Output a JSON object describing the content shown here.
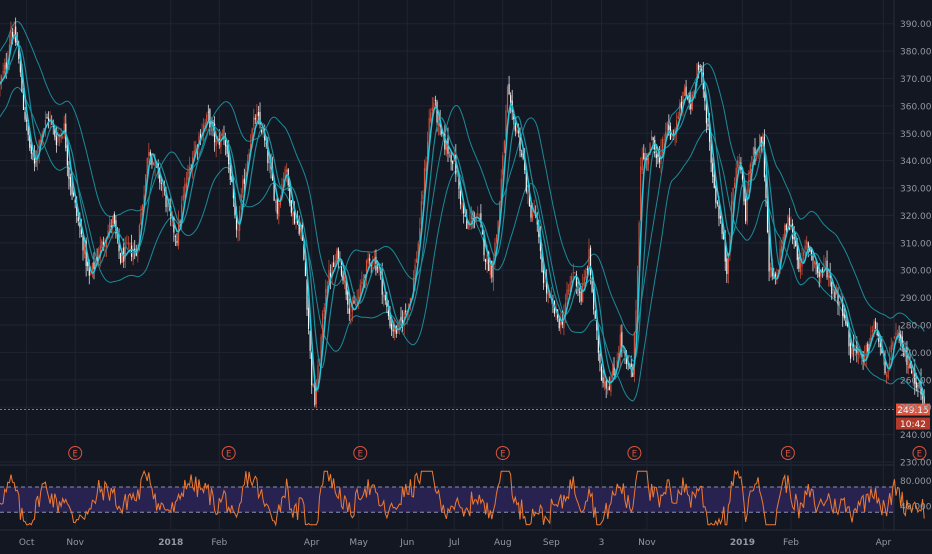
{
  "chart_data": [
    {
      "type": "candlestick",
      "panel": "price",
      "ylim": [
        230,
        395
      ],
      "y_ticks": [
        230,
        240,
        250,
        260,
        270,
        280,
        290,
        300,
        310,
        320,
        330,
        340,
        350,
        360,
        370,
        380,
        390
      ],
      "y_tick_labels": [
        "230.00",
        "240.00",
        "250.00",
        "260.00",
        "270.00",
        "280.00",
        "290.00",
        "300.00",
        "310.00",
        "320.00",
        "330.00",
        "340.00",
        "350.00",
        "360.00",
        "370.00",
        "380.00",
        "390.00"
      ],
      "x_range": [
        "2017-09-14",
        "2019-05-02"
      ],
      "x_ticks": [
        {
          "date": "2017-10-01",
          "label": "Oct",
          "bold": false
        },
        {
          "date": "2017-11-01",
          "label": "Nov",
          "bold": false
        },
        {
          "date": "2018-01-01",
          "label": "2018",
          "bold": true
        },
        {
          "date": "2018-02-01",
          "label": "Feb",
          "bold": false
        },
        {
          "date": "2018-04-01",
          "label": "Apr",
          "bold": false
        },
        {
          "date": "2018-05-01",
          "label": "May",
          "bold": false
        },
        {
          "date": "2018-06-01",
          "label": "Jun",
          "bold": false
        },
        {
          "date": "2018-07-01",
          "label": "Jul",
          "bold": false
        },
        {
          "date": "2018-08-01",
          "label": "Aug",
          "bold": false
        },
        {
          "date": "2018-09-01",
          "label": "Sep",
          "bold": false
        },
        {
          "date": "2018-10-03",
          "label": "3",
          "bold": false
        },
        {
          "date": "2018-11-01",
          "label": "Nov",
          "bold": false
        },
        {
          "date": "2019-01-01",
          "label": "2019",
          "bold": true
        },
        {
          "date": "2019-02-01",
          "label": "Feb",
          "bold": false
        },
        {
          "date": "2019-04-01",
          "label": "Apr",
          "bold": false
        }
      ],
      "close_path": [
        [
          "2017-09-14",
          368
        ],
        [
          "2017-09-18",
          375
        ],
        [
          "2017-09-21",
          388
        ],
        [
          "2017-09-25",
          382
        ],
        [
          "2017-09-29",
          360
        ],
        [
          "2017-10-03",
          345
        ],
        [
          "2017-10-06",
          338
        ],
        [
          "2017-10-10",
          350
        ],
        [
          "2017-10-15",
          356
        ],
        [
          "2017-10-20",
          348
        ],
        [
          "2017-10-25",
          352
        ],
        [
          "2017-10-28",
          335
        ],
        [
          "2017-11-02",
          320
        ],
        [
          "2017-11-06",
          310
        ],
        [
          "2017-11-10",
          297
        ],
        [
          "2017-11-15",
          305
        ],
        [
          "2017-11-20",
          312
        ],
        [
          "2017-11-25",
          318
        ],
        [
          "2017-11-30",
          304
        ],
        [
          "2017-12-05",
          308
        ],
        [
          "2017-12-10",
          306
        ],
        [
          "2017-12-15",
          330
        ],
        [
          "2017-12-18",
          345
        ],
        [
          "2017-12-22",
          338
        ],
        [
          "2017-12-27",
          330
        ],
        [
          "2018-01-01",
          318
        ],
        [
          "2018-01-05",
          312
        ],
        [
          "2018-01-10",
          330
        ],
        [
          "2018-01-15",
          342
        ],
        [
          "2018-01-20",
          350
        ],
        [
          "2018-01-25",
          356
        ],
        [
          "2018-01-30",
          346
        ],
        [
          "2018-02-04",
          350
        ],
        [
          "2018-02-08",
          335
        ],
        [
          "2018-02-12",
          312
        ],
        [
          "2018-02-16",
          330
        ],
        [
          "2018-02-20",
          345
        ],
        [
          "2018-02-24",
          356
        ],
        [
          "2018-02-28",
          352
        ],
        [
          "2018-03-05",
          338
        ],
        [
          "2018-03-10",
          322
        ],
        [
          "2018-03-15",
          338
        ],
        [
          "2018-03-20",
          320
        ],
        [
          "2018-03-25",
          315
        ],
        [
          "2018-03-28",
          298
        ],
        [
          "2018-04-01",
          260
        ],
        [
          "2018-04-03",
          252
        ],
        [
          "2018-04-06",
          268
        ],
        [
          "2018-04-10",
          295
        ],
        [
          "2018-04-14",
          300
        ],
        [
          "2018-04-18",
          306
        ],
        [
          "2018-04-22",
          296
        ],
        [
          "2018-04-26",
          284
        ],
        [
          "2018-05-01",
          290
        ],
        [
          "2018-05-05",
          300
        ],
        [
          "2018-05-10",
          305
        ],
        [
          "2018-05-14",
          300
        ],
        [
          "2018-05-18",
          288
        ],
        [
          "2018-05-22",
          279
        ],
        [
          "2018-05-26",
          278
        ],
        [
          "2018-05-31",
          285
        ],
        [
          "2018-06-04",
          292
        ],
        [
          "2018-06-08",
          310
        ],
        [
          "2018-06-12",
          335
        ],
        [
          "2018-06-15",
          355
        ],
        [
          "2018-06-18",
          362
        ],
        [
          "2018-06-22",
          350
        ],
        [
          "2018-06-26",
          345
        ],
        [
          "2018-07-01",
          340
        ],
        [
          "2018-07-05",
          326
        ],
        [
          "2018-07-09",
          315
        ],
        [
          "2018-07-13",
          320
        ],
        [
          "2018-07-17",
          318
        ],
        [
          "2018-07-21",
          305
        ],
        [
          "2018-07-25",
          300
        ],
        [
          "2018-07-29",
          318
        ],
        [
          "2018-08-01",
          340
        ],
        [
          "2018-08-04",
          365
        ],
        [
          "2018-08-07",
          355
        ],
        [
          "2018-08-10",
          352
        ],
        [
          "2018-08-14",
          340
        ],
        [
          "2018-08-18",
          322
        ],
        [
          "2018-08-22",
          320
        ],
        [
          "2018-08-26",
          300
        ],
        [
          "2018-08-30",
          290
        ],
        [
          "2018-09-03",
          285
        ],
        [
          "2018-09-07",
          280
        ],
        [
          "2018-09-11",
          290
        ],
        [
          "2018-09-15",
          300
        ],
        [
          "2018-09-20",
          290
        ],
        [
          "2018-09-25",
          305
        ],
        [
          "2018-09-29",
          280
        ],
        [
          "2018-10-03",
          262
        ],
        [
          "2018-10-07",
          258
        ],
        [
          "2018-10-11",
          262
        ],
        [
          "2018-10-15",
          275
        ],
        [
          "2018-10-19",
          265
        ],
        [
          "2018-10-23",
          262
        ],
        [
          "2018-10-26",
          300
        ],
        [
          "2018-10-28",
          340
        ],
        [
          "2018-11-01",
          342
        ],
        [
          "2018-11-05",
          348
        ],
        [
          "2018-11-09",
          338
        ],
        [
          "2018-11-13",
          352
        ],
        [
          "2018-11-17",
          348
        ],
        [
          "2018-11-21",
          356
        ],
        [
          "2018-11-25",
          365
        ],
        [
          "2018-11-29",
          360
        ],
        [
          "2018-12-03",
          375
        ],
        [
          "2018-12-06",
          370
        ],
        [
          "2018-12-10",
          352
        ],
        [
          "2018-12-14",
          330
        ],
        [
          "2018-12-18",
          318
        ],
        [
          "2018-12-22",
          300
        ],
        [
          "2018-12-26",
          330
        ],
        [
          "2018-12-30",
          342
        ],
        [
          "2019-01-03",
          320
        ],
        [
          "2019-01-06",
          340
        ],
        [
          "2019-01-10",
          345
        ],
        [
          "2019-01-14",
          348
        ],
        [
          "2019-01-18",
          300
        ],
        [
          "2019-01-22",
          295
        ],
        [
          "2019-01-26",
          310
        ],
        [
          "2019-01-30",
          318
        ],
        [
          "2019-02-03",
          312
        ],
        [
          "2019-02-07",
          300
        ],
        [
          "2019-02-11",
          310
        ],
        [
          "2019-02-15",
          305
        ],
        [
          "2019-02-19",
          298
        ],
        [
          "2019-02-23",
          302
        ],
        [
          "2019-02-27",
          294
        ],
        [
          "2019-03-03",
          290
        ],
        [
          "2019-03-07",
          285
        ],
        [
          "2019-03-11",
          270
        ],
        [
          "2019-03-15",
          272
        ],
        [
          "2019-03-19",
          265
        ],
        [
          "2019-03-23",
          275
        ],
        [
          "2019-03-27",
          280
        ],
        [
          "2019-03-31",
          268
        ],
        [
          "2019-04-04",
          262
        ],
        [
          "2019-04-08",
          278
        ],
        [
          "2019-04-12",
          272
        ],
        [
          "2019-04-16",
          268
        ],
        [
          "2019-04-20",
          262
        ],
        [
          "2019-04-24",
          258
        ],
        [
          "2019-04-27",
          249.15
        ]
      ],
      "last_price": 249.15,
      "last_price_label": "249.15",
      "countdown_label": "10:42",
      "earnings_marker": "E",
      "earnings_dates": [
        "2017-11-01",
        "2018-02-07",
        "2018-05-02",
        "2018-08-01",
        "2018-10-24",
        "2019-01-30",
        "2019-04-24"
      ],
      "grid": true,
      "colors": {
        "background": "#131722",
        "grid": "#1f2433",
        "up": "#e0533c",
        "down": "#ffffff",
        "ma": "#26c6da",
        "band": "#1b8a98",
        "price_line": "#e0533c",
        "axis_text": "#9598a1"
      }
    },
    {
      "type": "line",
      "panel": "oscillator",
      "ylim": [
        5,
        100
      ],
      "y_ticks": [
        80,
        40
      ],
      "y_tick_labels": [
        "80.0000",
        "40.0000"
      ],
      "band": [
        70,
        30
      ],
      "colors": {
        "line": "#f07a30",
        "band_fill": "#2b2356",
        "band_edge": "#8a8fb4"
      }
    }
  ]
}
